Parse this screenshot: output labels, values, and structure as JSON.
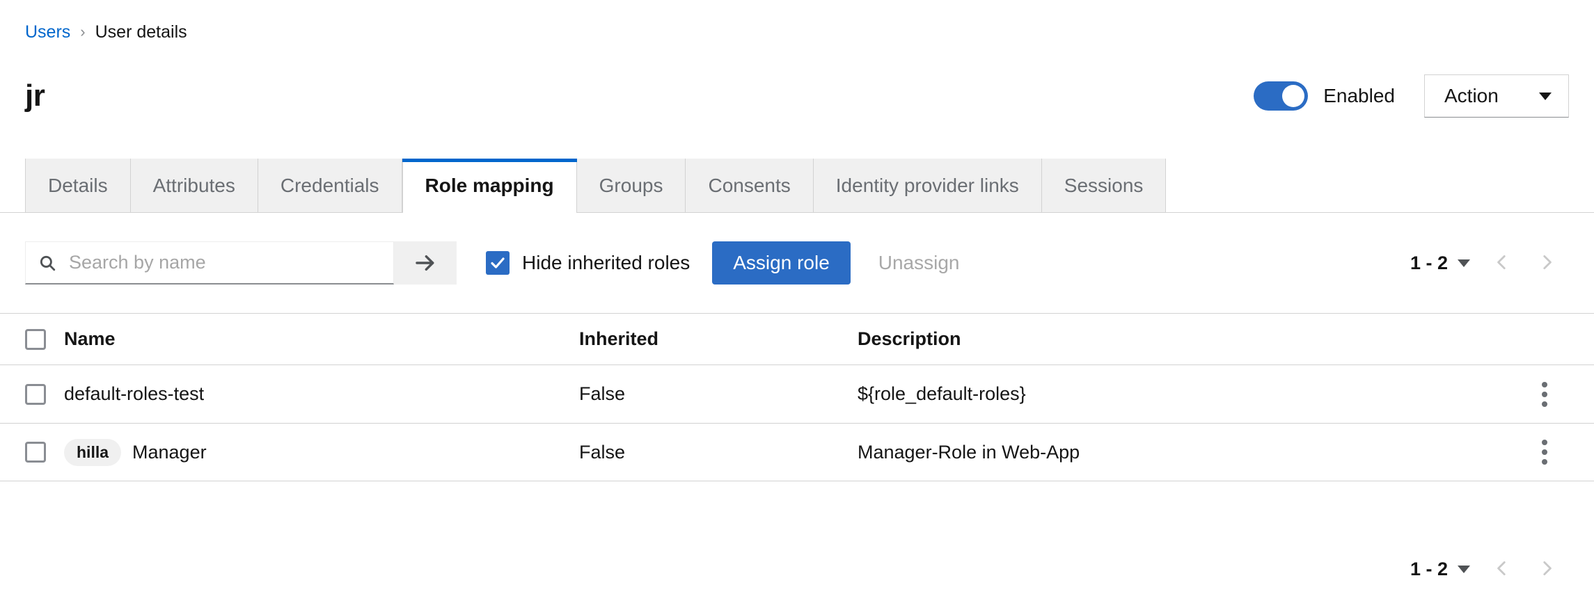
{
  "breadcrumb": {
    "parent": "Users",
    "separator": "›",
    "current": "User details"
  },
  "header": {
    "title": "jr",
    "toggle": {
      "label": "Enabled",
      "state": "on",
      "color": "#2b6cc4"
    },
    "action_button": {
      "label": "Action",
      "icon": "chevron-down-icon"
    }
  },
  "tabs": [
    {
      "label": "Details",
      "active": false
    },
    {
      "label": "Attributes",
      "active": false
    },
    {
      "label": "Credentials",
      "active": false
    },
    {
      "label": "Role mapping",
      "active": true
    },
    {
      "label": "Groups",
      "active": false
    },
    {
      "label": "Consents",
      "active": false
    },
    {
      "label": "Identity provider links",
      "active": false
    },
    {
      "label": "Sessions",
      "active": false
    }
  ],
  "toolbar": {
    "search": {
      "placeholder": "Search by name",
      "value": "",
      "icon": "search-icon"
    },
    "search_submit_icon": "arrow-right-icon",
    "hide_inherited": {
      "label": "Hide inherited roles",
      "checked": true
    },
    "assign_label": "Assign role",
    "unassign_label": "Unassign",
    "accent_color": "#2b6cc4"
  },
  "pagination": {
    "range": "1 - 2",
    "prev_icon": "chevron-left-icon",
    "next_icon": "chevron-right-icon",
    "caret_icon": "caret-down-icon"
  },
  "table": {
    "columns": [
      "Name",
      "Inherited",
      "Description"
    ],
    "rows": [
      {
        "badge": "",
        "name": "default-roles-test",
        "inherited": "False",
        "description": "${role_default-roles}",
        "kebab_icon": "kebab-menu-icon"
      },
      {
        "badge": "hilla",
        "name": "Manager",
        "inherited": "False",
        "description": "Manager-Role in Web-App",
        "kebab_icon": "kebab-menu-icon"
      }
    ]
  }
}
